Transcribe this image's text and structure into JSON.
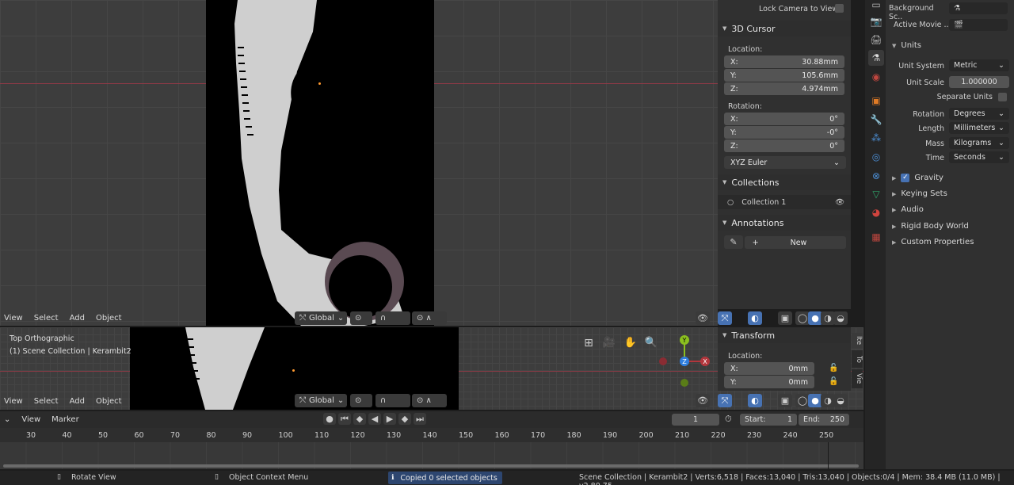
{
  "viewport_top": {
    "menu": [
      "View",
      "Select",
      "Add",
      "Object"
    ],
    "orientation": "Global",
    "n_panel": {
      "lock_camera_label": "Lock Camera to View",
      "cursor_panel": "3D Cursor",
      "location_label": "Location:",
      "location": [
        {
          "axis": "X:",
          "value": "30.88mm"
        },
        {
          "axis": "Y:",
          "value": "105.6mm"
        },
        {
          "axis": "Z:",
          "value": "4.974mm"
        }
      ],
      "rotation_label": "Rotation:",
      "rotation": [
        {
          "axis": "X:",
          "value": "0°"
        },
        {
          "axis": "Y:",
          "value": "-0°"
        },
        {
          "axis": "Z:",
          "value": "0°"
        }
      ],
      "rotation_mode": "XYZ Euler",
      "collections_panel": "Collections",
      "collection_item": "Collection 1",
      "annotations_panel": "Annotations",
      "new_label": "New"
    }
  },
  "viewport_bottom": {
    "view_name": "Top Orthographic",
    "collection_path": "(1) Scene Collection | Kerambit2",
    "menu": [
      "View",
      "Select",
      "Add",
      "Object"
    ],
    "orientation": "Global",
    "gizmo": {
      "y": "Y",
      "z": "Z",
      "x": "X"
    },
    "n_panel": {
      "transform_panel": "Transform",
      "location_label": "Location:",
      "location": [
        {
          "axis": "X:",
          "value": "0mm"
        },
        {
          "axis": "Y:",
          "value": "0mm"
        }
      ],
      "tabs": [
        "Ite",
        "To",
        "Vie"
      ]
    }
  },
  "properties": {
    "background_label": "Background Sc..",
    "movie_clip_label": "Active Movie ..",
    "units_panel": "Units",
    "unit_system_label": "Unit System",
    "unit_system": "Metric",
    "unit_scale_label": "Unit Scale",
    "unit_scale": "1.000000",
    "separate_units_label": "Separate Units",
    "rotation_label": "Rotation",
    "rotation": "Degrees",
    "length_label": "Length",
    "length": "Millimeters",
    "mass_label": "Mass",
    "mass": "Kilograms",
    "time_label": "Time",
    "time": "Seconds",
    "subpanels": [
      "Gravity",
      "Keying Sets",
      "Audio",
      "Rigid Body World",
      "Custom Properties"
    ]
  },
  "timeline": {
    "menu": [
      "View",
      "Marker"
    ],
    "current_frame": "1",
    "start_label": "Start:",
    "start": "1",
    "end_label": "End:",
    "end": "250",
    "ticks": [
      "30",
      "40",
      "50",
      "60",
      "70",
      "80",
      "90",
      "100",
      "110",
      "120",
      "130",
      "140",
      "150",
      "160",
      "170",
      "180",
      "190",
      "200",
      "210",
      "220",
      "230",
      "240",
      "250"
    ]
  },
  "status_bar": {
    "rotate_view": "Rotate View",
    "context_menu": "Object Context Menu",
    "message": "Copied 0 selected objects",
    "scene_info": "Scene Collection | Kerambit2 | Verts:6,518 | Faces:13,040 | Tris:13,040 | Objects:0/4 | Mem: 38.4 MB (11.0 MB) | v2.80.75"
  },
  "colors": {
    "accent": "#4772b3",
    "axis_x": "#b2363c",
    "axis_y": "#8bbf1f",
    "axis_z": "#2f7fe0"
  }
}
